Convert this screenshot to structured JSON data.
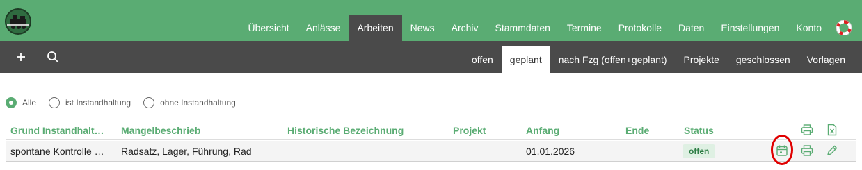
{
  "nav": {
    "items": [
      {
        "label": "Übersicht"
      },
      {
        "label": "Anlässe"
      },
      {
        "label": "Arbeiten",
        "active": true
      },
      {
        "label": "News"
      },
      {
        "label": "Archiv"
      },
      {
        "label": "Stammdaten"
      },
      {
        "label": "Termine"
      },
      {
        "label": "Protokolle"
      },
      {
        "label": "Daten"
      },
      {
        "label": "Einstellungen"
      },
      {
        "label": "Konto"
      }
    ],
    "help_icon": "lifebuoy-icon"
  },
  "toolbar": {
    "add_icon": "plus-icon",
    "search_icon": "search-icon"
  },
  "subtabs": [
    {
      "label": "offen"
    },
    {
      "label": "geplant",
      "active": true
    },
    {
      "label": "nach Fzg (offen+geplant)"
    },
    {
      "label": "Projekte"
    },
    {
      "label": "geschlossen"
    },
    {
      "label": "Vorlagen"
    }
  ],
  "filters": {
    "options": [
      {
        "label": "Alle",
        "checked": true
      },
      {
        "label": "ist Instandhaltung",
        "checked": false
      },
      {
        "label": "ohne Instandhaltung",
        "checked": false
      }
    ]
  },
  "table": {
    "columns": [
      "Grund Instandhalt…",
      "Mangelbeschrieb",
      "Historische Bezeichnung",
      "Projekt",
      "Anfang",
      "Ende",
      "Status"
    ],
    "header_icons": [
      "print-icon",
      "excel-export-icon"
    ],
    "rows": [
      {
        "grund": "spontane Kontrolle …",
        "mangel": "Radsatz, Lager, Führung, Rad",
        "historisch": "",
        "projekt": "",
        "anfang": "01.01.2026",
        "ende": "",
        "status": "offen",
        "actions": [
          "calendar-icon",
          "print-icon",
          "edit-icon"
        ]
      }
    ]
  },
  "colors": {
    "primary_green": "#5aac73",
    "dark_bar": "#4a4a4a",
    "highlight_red": "#e00000"
  }
}
